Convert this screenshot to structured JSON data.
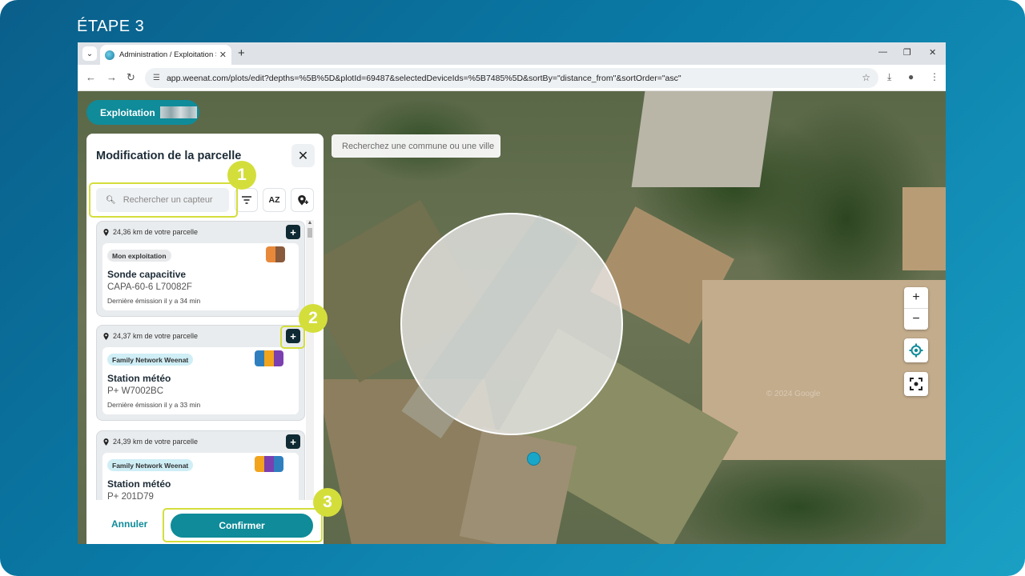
{
  "slide": {
    "step_title": "ÉTAPE 3"
  },
  "browser": {
    "tab_title": "Administration / Exploitation Sa",
    "tab_close": "✕",
    "new_tab": "+",
    "url": "app.weenat.com/plots/edit?depths=%5B%5D&plotId=69487&selectedDeviceIds=%5B7485%5D&sortBy=\"distance_from\"&sortOrder=\"asc\"",
    "window_controls": [
      "—",
      "❐",
      "✕"
    ]
  },
  "map": {
    "farm_label": "Exploitation",
    "search_placeholder": "Recherchez une commune ou une ville",
    "attribution": "© 2024 Google",
    "zoom_in": "+",
    "zoom_out": "−"
  },
  "panel": {
    "title": "Modification de la parcelle",
    "close": "✕",
    "search_placeholder": "Rechercher un capteur",
    "sort_label": "AZ",
    "devices": [
      {
        "distance": "24,36 km de votre parcelle",
        "owner": "Mon exploitation",
        "owner_type": "own",
        "name": "Sonde capacitive",
        "serial": "CAPA-60-6 L70082F",
        "last_emission": "Dernière émission il y a 34 min",
        "icons": [
          "soil-moisture-icon",
          "soil-temperature-icon"
        ],
        "icon_colors": [
          "#e8893a",
          "#8a5a3c"
        ]
      },
      {
        "distance": "24,37 km de votre parcelle",
        "owner": "Family Network Weenat",
        "owner_type": "network",
        "name": "Station météo",
        "serial": "P+ W7002BC",
        "last_emission": "Dernière émission il y a 33 min",
        "icons": [
          "rain-gauge-icon",
          "temperature-icon",
          "humidity-icon"
        ],
        "icon_colors": [
          "#2f7fbf",
          "#f2a41c",
          "#7b3fb0"
        ]
      },
      {
        "distance": "24,39 km de votre parcelle",
        "owner": "Family Network Weenat",
        "owner_type": "network",
        "name": "Station météo",
        "serial": "P+ 201D79",
        "last_emission": "",
        "icons": [
          "temperature-icon",
          "humidity-icon",
          "rain-gauge-icon"
        ],
        "icon_colors": [
          "#f2a41c",
          "#7b3fb0",
          "#2f7fbf"
        ]
      }
    ],
    "add_label": "+",
    "cancel_label": "Annuler",
    "confirm_label": "Confirmer"
  },
  "annotations": {
    "steps": [
      "1",
      "2",
      "3"
    ],
    "color": "#d4de3b"
  }
}
